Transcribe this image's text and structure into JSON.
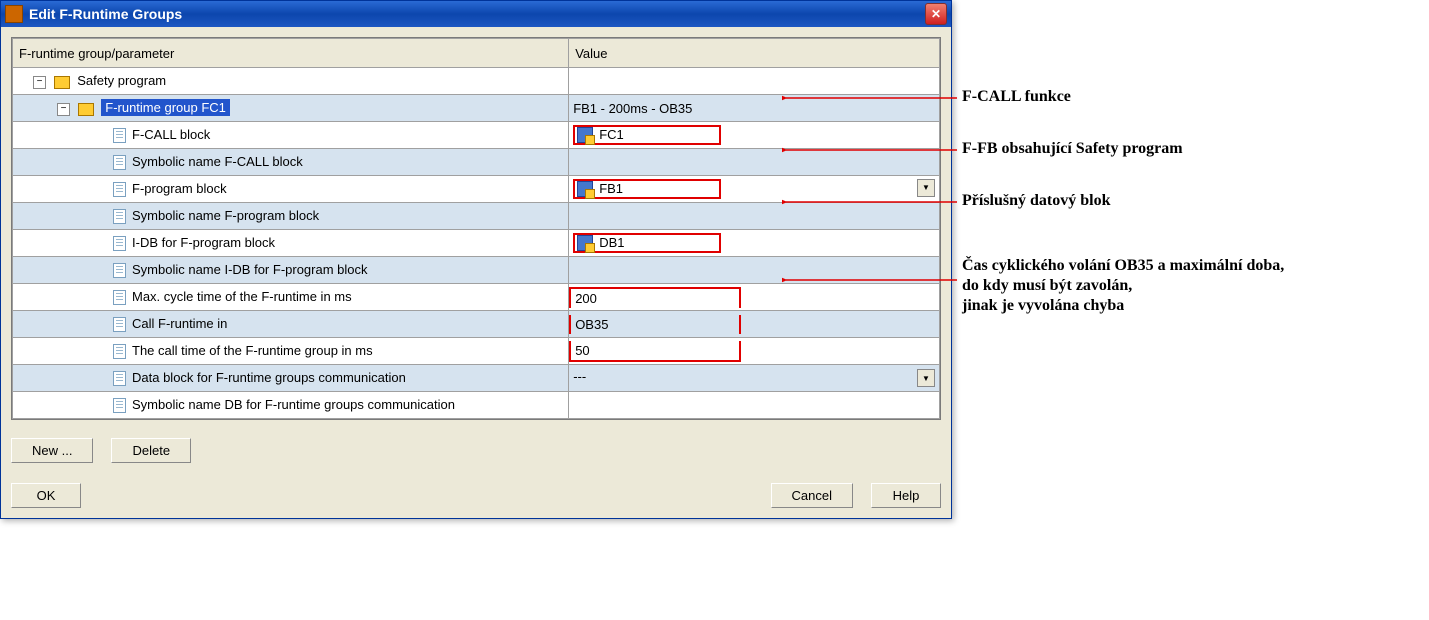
{
  "window": {
    "title": "Edit F-Runtime Groups"
  },
  "headers": {
    "param": "F-runtime group/parameter",
    "value": "Value"
  },
  "tree": {
    "root": "Safety program",
    "group": "F-runtime group FC1",
    "group_value": "FB1 - 200ms - OB35"
  },
  "rows": [
    {
      "label": "F-CALL block",
      "value": "FC1",
      "icon": true,
      "box": true
    },
    {
      "label": "Symbolic name F-CALL block",
      "value": ""
    },
    {
      "label": "F-program block",
      "value": "FB1",
      "icon": true,
      "box": true,
      "dropdown": true
    },
    {
      "label": "Symbolic name F-program block",
      "value": ""
    },
    {
      "label": "I-DB for F-program block",
      "value": "DB1",
      "icon": true,
      "box": true
    },
    {
      "label": "Symbolic name I-DB for F-program block",
      "value": ""
    },
    {
      "label": "Max. cycle time of the F-runtime in ms",
      "value": "200",
      "box_tall_top": true
    },
    {
      "label": "Call F-runtime in",
      "value": "OB35",
      "box_tall_mid": true
    },
    {
      "label": "The call time of the F-runtime group in ms",
      "value": "50",
      "box_tall_bot": true
    },
    {
      "label": "Data block for F-runtime groups communication",
      "value": "---",
      "dropdown": true
    },
    {
      "label": "Symbolic name DB for F-runtime groups communication",
      "value": ""
    }
  ],
  "buttons": {
    "new": "New ...",
    "delete": "Delete",
    "ok": "OK",
    "cancel": "Cancel",
    "help": "Help"
  },
  "annotations": {
    "a1": "F-CALL funkce",
    "a2": "F-FB obsahující Safety program",
    "a3": "Příslušný datový blok",
    "a4_l1": "Čas cyklického volání OB35 a maximální doba,",
    "a4_l2": "do kdy musí být zavolán,",
    "a4_l3": " jinak je vyvolána chyba"
  }
}
